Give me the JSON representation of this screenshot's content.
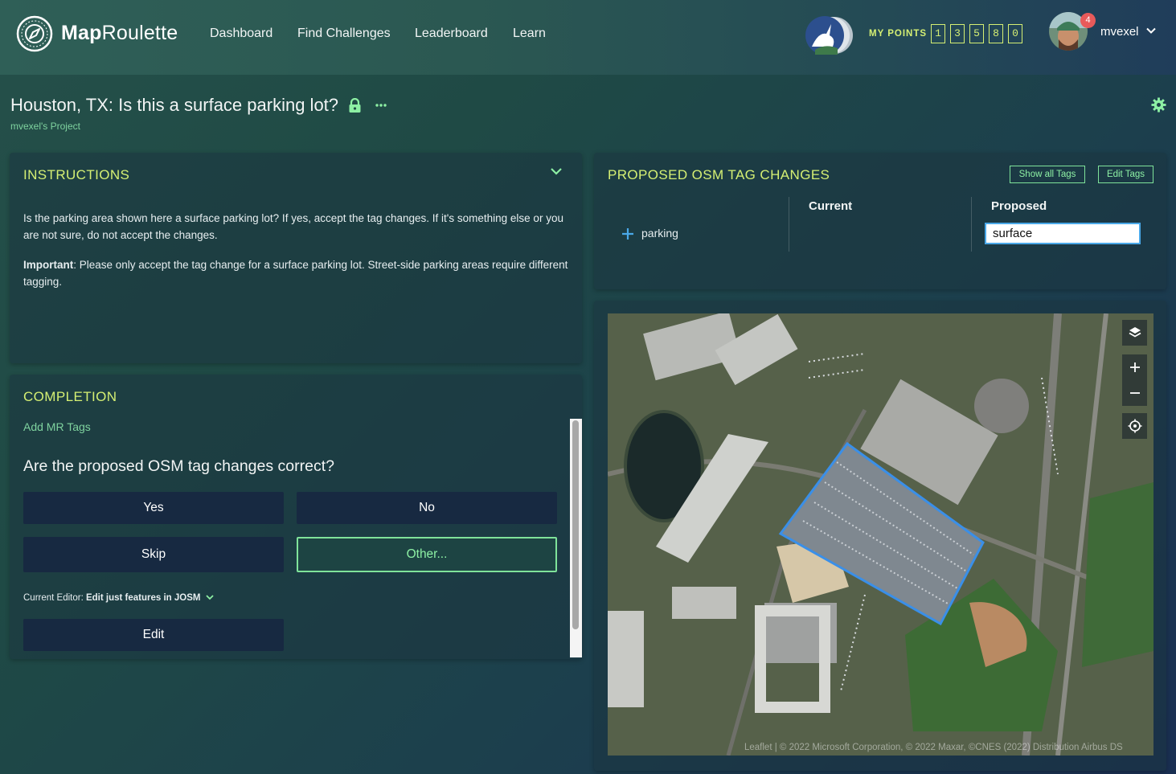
{
  "app": {
    "brand_bold": "Map",
    "brand_rest": "Roulette",
    "nav": [
      "Dashboard",
      "Find Challenges",
      "Leaderboard",
      "Learn"
    ],
    "points_label": "MY POINTS",
    "points_digits": [
      "1",
      "3",
      "5",
      "8",
      "0"
    ],
    "username": "mvexel",
    "notification_count": "4",
    "accent_color": "#d5ef73",
    "green_color": "#7fe39a"
  },
  "challenge": {
    "title": "Houston, TX: Is this a surface parking lot?",
    "project": "mvexel's Project"
  },
  "instructions": {
    "title": "INSTRUCTIONS",
    "paragraph1": "Is the parking area shown here a surface parking lot? If yes, accept the tag changes. If it's something else or you are not sure, do not accept the changes.",
    "important_label": "Important",
    "paragraph2": ": Please only accept the tag change for a surface parking lot. Street-side parking areas require different tagging."
  },
  "completion": {
    "title": "COMPLETION",
    "add_tags": "Add MR Tags",
    "question": "Are the proposed OSM tag changes correct?",
    "yes": "Yes",
    "no": "No",
    "skip": "Skip",
    "other": "Other...",
    "editor_prefix": "Current Editor: ",
    "editor_value": "Edit just features in JOSM",
    "edit": "Edit"
  },
  "tag_changes": {
    "title": "PROPOSED OSM TAG CHANGES",
    "show_all": "Show all Tags",
    "edit_tags": "Edit Tags",
    "col_current": "Current",
    "col_proposed": "Proposed",
    "tag_key": "parking",
    "proposed_value": "surface"
  },
  "map": {
    "attribution": "Leaflet | © 2022 Microsoft Corporation, © 2022 Maxar, ©CNES (2022) Distribution Airbus DS"
  }
}
